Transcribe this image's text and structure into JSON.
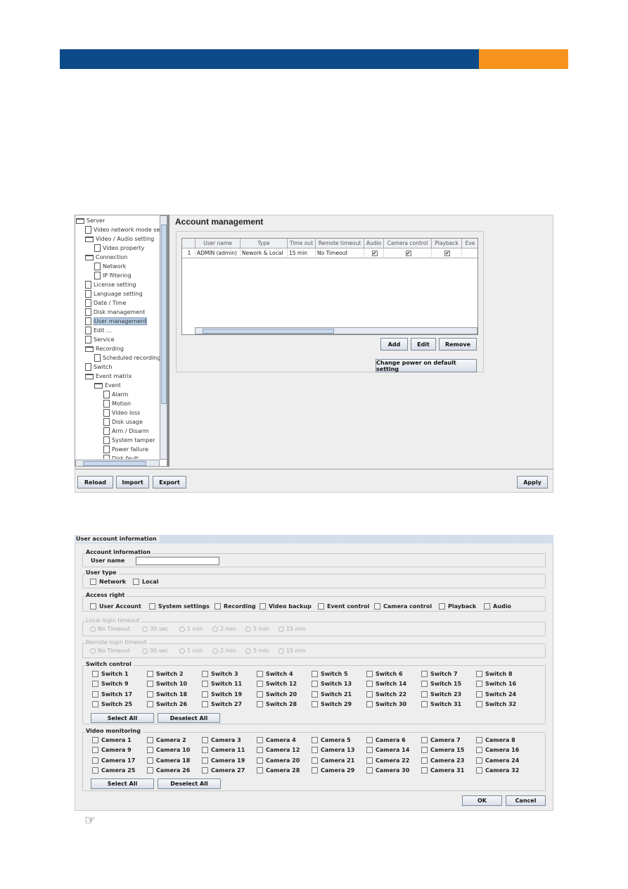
{
  "colors": {
    "header_blue": "#0d4a8a",
    "header_orange": "#f7941d"
  },
  "tree": {
    "items": [
      {
        "label": "Server",
        "level": 0,
        "icon": "folder-icon"
      },
      {
        "label": "Video network mode setti",
        "level": 1,
        "icon": "document-icon"
      },
      {
        "label": "Video / Audio setting",
        "level": 1,
        "icon": "folder-icon"
      },
      {
        "label": "Video property",
        "level": 2,
        "icon": "document-icon"
      },
      {
        "label": "Connection",
        "level": 1,
        "icon": "folder-icon"
      },
      {
        "label": "Network",
        "level": 2,
        "icon": "document-icon"
      },
      {
        "label": "IP filtering",
        "level": 2,
        "icon": "document-icon"
      },
      {
        "label": "License setting",
        "level": 1,
        "icon": "document-icon"
      },
      {
        "label": "Language setting",
        "level": 1,
        "icon": "document-icon"
      },
      {
        "label": "Date / Time",
        "level": 1,
        "icon": "document-icon"
      },
      {
        "label": "Disk management",
        "level": 1,
        "icon": "document-icon"
      },
      {
        "label": "User management",
        "level": 1,
        "icon": "document-icon",
        "selected": true
      },
      {
        "label": "Edit ...",
        "level": 1,
        "icon": "document-icon"
      },
      {
        "label": "Service",
        "level": 1,
        "icon": "document-icon"
      },
      {
        "label": "Recording",
        "level": 1,
        "icon": "folder-icon"
      },
      {
        "label": "Scheduled recording",
        "level": 2,
        "icon": "document-icon"
      },
      {
        "label": "Switch",
        "level": 1,
        "icon": "document-icon"
      },
      {
        "label": "Event matrix",
        "level": 1,
        "icon": "folder-icon"
      },
      {
        "label": "Event",
        "level": 2,
        "icon": "folder-icon"
      },
      {
        "label": "Alarm",
        "level": 3,
        "icon": "document-icon"
      },
      {
        "label": "Motion",
        "level": 3,
        "icon": "document-icon"
      },
      {
        "label": "Video loss",
        "level": 3,
        "icon": "document-icon"
      },
      {
        "label": "Disk usage",
        "level": 3,
        "icon": "document-icon"
      },
      {
        "label": "Arm / Disarm",
        "level": 3,
        "icon": "document-icon"
      },
      {
        "label": "System tamper",
        "level": 3,
        "icon": "document-icon"
      },
      {
        "label": "Power failure",
        "level": 3,
        "icon": "document-icon"
      },
      {
        "label": "Disk fault",
        "level": 3,
        "icon": "document-icon"
      }
    ]
  },
  "account": {
    "title": "Account management",
    "columns": [
      "",
      "User name",
      "Type",
      "Time out",
      "Remote timeout",
      "Audio",
      "Camera control",
      "Playback",
      "Eve"
    ],
    "rows": [
      [
        "1",
        "ADMIN (admin)",
        "Nework & Local",
        "15 min",
        "No Timeout",
        true,
        true,
        true,
        ""
      ]
    ],
    "add": "Add",
    "edit": "Edit",
    "remove": "Remove",
    "change_power": "Change power on default setting"
  },
  "bottom": {
    "reload": "Reload",
    "import": "Import",
    "export": "Export",
    "apply": "Apply"
  },
  "dialog": {
    "title": "User account information",
    "account_info": "Account information",
    "user_name_label": "User name",
    "user_name_value": "",
    "user_type": "User type",
    "user_types": [
      "Network",
      "Local"
    ],
    "access_right": "Access right",
    "access_rights": [
      "User Account",
      "System settings",
      "Recording",
      "Video backup",
      "Event control",
      "Camera control",
      "Playback",
      "Audio"
    ],
    "local_timeout": "Local login timeout",
    "remote_timeout": "Remote login timeout",
    "timeouts": [
      "No Timeout",
      "30 sec",
      "1 min",
      "2 min",
      "5 min",
      "15 min"
    ],
    "switch_control": "Switch control",
    "switches": [
      "Switch 1",
      "Switch 2",
      "Switch 3",
      "Switch 4",
      "Switch 5",
      "Switch 6",
      "Switch 7",
      "Switch 8",
      "Switch 9",
      "Switch 10",
      "Switch 11",
      "Switch 12",
      "Switch 13",
      "Switch 14",
      "Switch 15",
      "Switch 16",
      "Switch 17",
      "Switch 18",
      "Switch 19",
      "Switch 20",
      "Switch 21",
      "Switch 22",
      "Switch 23",
      "Switch 24",
      "Switch 25",
      "Switch 26",
      "Switch 27",
      "Switch 28",
      "Switch 29",
      "Switch 30",
      "Switch 31",
      "Switch 32"
    ],
    "video_monitoring": "Video monitoring",
    "cameras": [
      "Camera 1",
      "Camera 2",
      "Camera 3",
      "Camera 4",
      "Camera 5",
      "Camera 6",
      "Camera 7",
      "Camera 8",
      "Camera 9",
      "Camera 10",
      "Camera 11",
      "Camera 12",
      "Camera 13",
      "Camera 14",
      "Camera 15",
      "Camera 16",
      "Camera 17",
      "Camera 18",
      "Camera 19",
      "Camera 20",
      "Camera 21",
      "Camera 22",
      "Camera 23",
      "Camera 24",
      "Camera 25",
      "Camera 26",
      "Camera 27",
      "Camera 28",
      "Camera 29",
      "Camera 30",
      "Camera 31",
      "Camera 32"
    ],
    "select_all": "Select All",
    "deselect_all": "Deselect All",
    "ok": "OK",
    "cancel": "Cancel"
  },
  "note_icon": "pointing-hand-icon"
}
